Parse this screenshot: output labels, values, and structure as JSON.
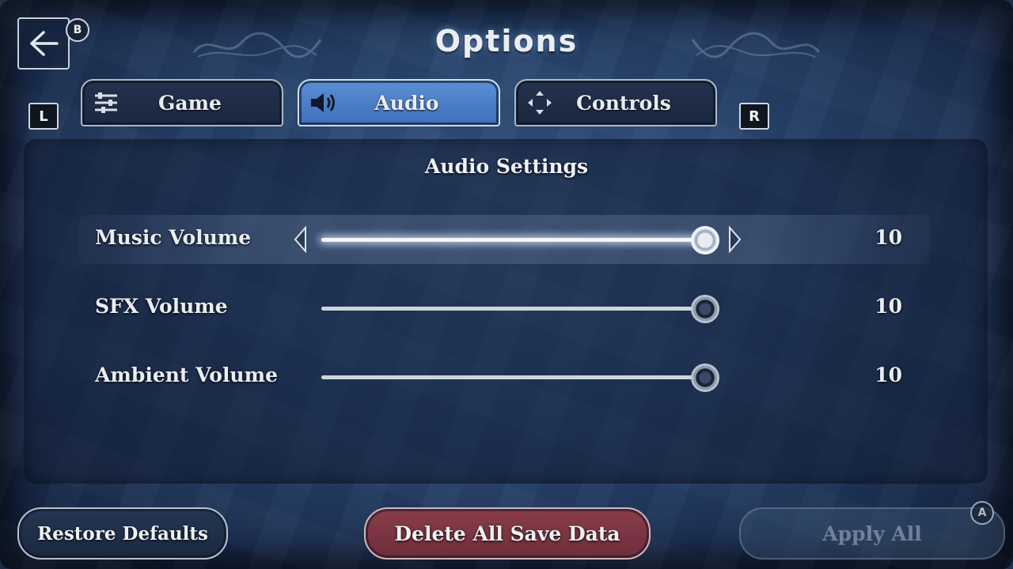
{
  "header": {
    "title": "Options",
    "back_badge": "B"
  },
  "shoulders": {
    "left": "L",
    "right": "R"
  },
  "tabs": [
    {
      "label": "Game",
      "icon": "sliders-icon",
      "active": false
    },
    {
      "label": "Audio",
      "icon": "speaker-icon",
      "active": true
    },
    {
      "label": "Controls",
      "icon": "dpad-icon",
      "active": false
    }
  ],
  "panel": {
    "title": "Audio Settings",
    "settings": [
      {
        "label": "Music Volume",
        "value": "10",
        "level": 1.0,
        "selected": true
      },
      {
        "label": "SFX Volume",
        "value": "10",
        "level": 1.0,
        "selected": false
      },
      {
        "label": "Ambient Volume",
        "value": "10",
        "level": 1.0,
        "selected": false
      }
    ]
  },
  "footer": {
    "restore_label": "Restore Defaults",
    "delete_label": "Delete All Save Data",
    "apply_label": "Apply All",
    "apply_badge": "A"
  },
  "colors": {
    "active_tab": "#4f80c8",
    "delete_button": "#7d3643",
    "background": "#2a4670"
  }
}
